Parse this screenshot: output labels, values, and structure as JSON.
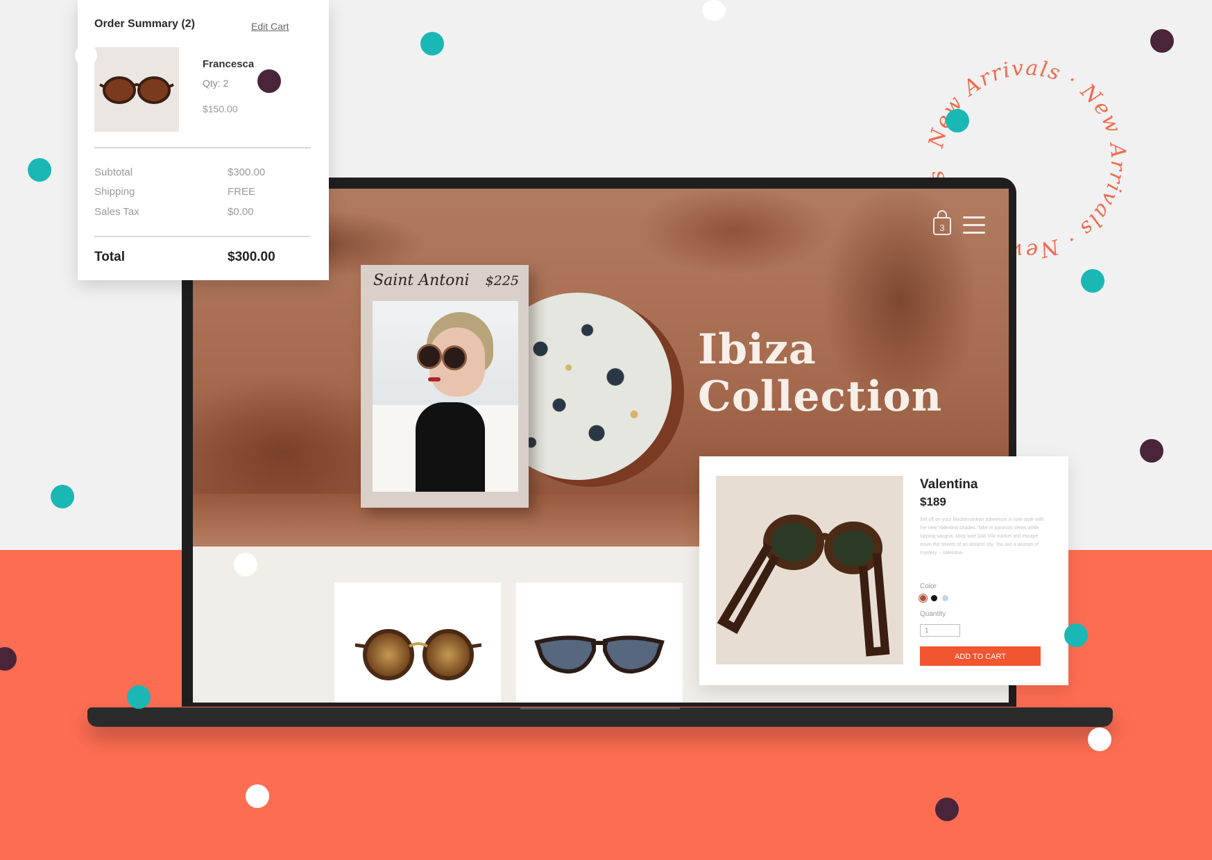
{
  "colors": {
    "teal": "#1bb7b4",
    "plum": "#4a2539",
    "coral": "#fd6d52",
    "cart_button": "#f25630"
  },
  "order_summary": {
    "title": "Order Summary (2)",
    "edit_cart": "Edit Cart",
    "item": {
      "name": "Francesca",
      "qty": "Qty: 2",
      "price": "$150.00"
    },
    "rows": [
      {
        "label": "Subtotal",
        "value": "$300.00"
      },
      {
        "label": "Shipping",
        "value": "FREE"
      },
      {
        "label": "Sales Tax",
        "value": "$0.00"
      }
    ],
    "total_label": "Total",
    "total_value": "$300.00"
  },
  "site": {
    "cart_count": "3",
    "hero_title_line1": "Ibiza",
    "hero_title_line2": "Collection",
    "featured": {
      "name": "Saint Antoni",
      "price": "$225"
    }
  },
  "product_detail": {
    "name": "Valentina",
    "price": "$189",
    "description": "Set off on your Mediterranean adventure in luxe style with the new Valentina shades. Take in parasols views while sipping sangria, shop luxe Dalt Vila market and escape down the streets of an ancient city. You are a woman of mystery – Valentina.",
    "color_label": "Color",
    "colors": [
      "#b0513e",
      "#111111",
      "#bfd6ec"
    ],
    "quantity_label": "Quantity",
    "quantity_value": "1",
    "add_to_cart": "ADD TO CART"
  },
  "badge_text": "New Arrivals · New Arrivals · New Arrivals ·"
}
